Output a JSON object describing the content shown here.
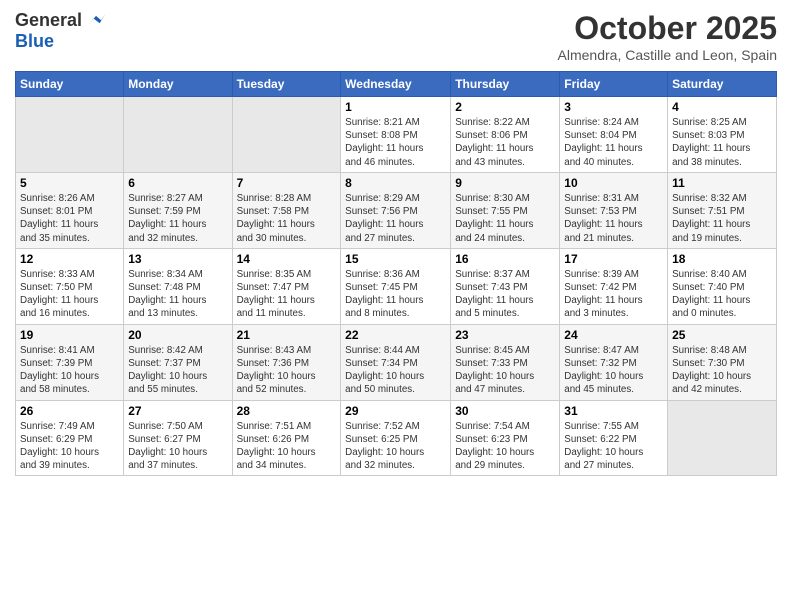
{
  "header": {
    "logo_general": "General",
    "logo_blue": "Blue",
    "month_title": "October 2025",
    "subtitle": "Almendra, Castille and Leon, Spain"
  },
  "weekdays": [
    "Sunday",
    "Monday",
    "Tuesday",
    "Wednesday",
    "Thursday",
    "Friday",
    "Saturday"
  ],
  "weeks": [
    [
      {
        "day": "",
        "info": ""
      },
      {
        "day": "",
        "info": ""
      },
      {
        "day": "",
        "info": ""
      },
      {
        "day": "1",
        "info": "Sunrise: 8:21 AM\nSunset: 8:08 PM\nDaylight: 11 hours\nand 46 minutes."
      },
      {
        "day": "2",
        "info": "Sunrise: 8:22 AM\nSunset: 8:06 PM\nDaylight: 11 hours\nand 43 minutes."
      },
      {
        "day": "3",
        "info": "Sunrise: 8:24 AM\nSunset: 8:04 PM\nDaylight: 11 hours\nand 40 minutes."
      },
      {
        "day": "4",
        "info": "Sunrise: 8:25 AM\nSunset: 8:03 PM\nDaylight: 11 hours\nand 38 minutes."
      }
    ],
    [
      {
        "day": "5",
        "info": "Sunrise: 8:26 AM\nSunset: 8:01 PM\nDaylight: 11 hours\nand 35 minutes."
      },
      {
        "day": "6",
        "info": "Sunrise: 8:27 AM\nSunset: 7:59 PM\nDaylight: 11 hours\nand 32 minutes."
      },
      {
        "day": "7",
        "info": "Sunrise: 8:28 AM\nSunset: 7:58 PM\nDaylight: 11 hours\nand 30 minutes."
      },
      {
        "day": "8",
        "info": "Sunrise: 8:29 AM\nSunset: 7:56 PM\nDaylight: 11 hours\nand 27 minutes."
      },
      {
        "day": "9",
        "info": "Sunrise: 8:30 AM\nSunset: 7:55 PM\nDaylight: 11 hours\nand 24 minutes."
      },
      {
        "day": "10",
        "info": "Sunrise: 8:31 AM\nSunset: 7:53 PM\nDaylight: 11 hours\nand 21 minutes."
      },
      {
        "day": "11",
        "info": "Sunrise: 8:32 AM\nSunset: 7:51 PM\nDaylight: 11 hours\nand 19 minutes."
      }
    ],
    [
      {
        "day": "12",
        "info": "Sunrise: 8:33 AM\nSunset: 7:50 PM\nDaylight: 11 hours\nand 16 minutes."
      },
      {
        "day": "13",
        "info": "Sunrise: 8:34 AM\nSunset: 7:48 PM\nDaylight: 11 hours\nand 13 minutes."
      },
      {
        "day": "14",
        "info": "Sunrise: 8:35 AM\nSunset: 7:47 PM\nDaylight: 11 hours\nand 11 minutes."
      },
      {
        "day": "15",
        "info": "Sunrise: 8:36 AM\nSunset: 7:45 PM\nDaylight: 11 hours\nand 8 minutes."
      },
      {
        "day": "16",
        "info": "Sunrise: 8:37 AM\nSunset: 7:43 PM\nDaylight: 11 hours\nand 5 minutes."
      },
      {
        "day": "17",
        "info": "Sunrise: 8:39 AM\nSunset: 7:42 PM\nDaylight: 11 hours\nand 3 minutes."
      },
      {
        "day": "18",
        "info": "Sunrise: 8:40 AM\nSunset: 7:40 PM\nDaylight: 11 hours\nand 0 minutes."
      }
    ],
    [
      {
        "day": "19",
        "info": "Sunrise: 8:41 AM\nSunset: 7:39 PM\nDaylight: 10 hours\nand 58 minutes."
      },
      {
        "day": "20",
        "info": "Sunrise: 8:42 AM\nSunset: 7:37 PM\nDaylight: 10 hours\nand 55 minutes."
      },
      {
        "day": "21",
        "info": "Sunrise: 8:43 AM\nSunset: 7:36 PM\nDaylight: 10 hours\nand 52 minutes."
      },
      {
        "day": "22",
        "info": "Sunrise: 8:44 AM\nSunset: 7:34 PM\nDaylight: 10 hours\nand 50 minutes."
      },
      {
        "day": "23",
        "info": "Sunrise: 8:45 AM\nSunset: 7:33 PM\nDaylight: 10 hours\nand 47 minutes."
      },
      {
        "day": "24",
        "info": "Sunrise: 8:47 AM\nSunset: 7:32 PM\nDaylight: 10 hours\nand 45 minutes."
      },
      {
        "day": "25",
        "info": "Sunrise: 8:48 AM\nSunset: 7:30 PM\nDaylight: 10 hours\nand 42 minutes."
      }
    ],
    [
      {
        "day": "26",
        "info": "Sunrise: 7:49 AM\nSunset: 6:29 PM\nDaylight: 10 hours\nand 39 minutes."
      },
      {
        "day": "27",
        "info": "Sunrise: 7:50 AM\nSunset: 6:27 PM\nDaylight: 10 hours\nand 37 minutes."
      },
      {
        "day": "28",
        "info": "Sunrise: 7:51 AM\nSunset: 6:26 PM\nDaylight: 10 hours\nand 34 minutes."
      },
      {
        "day": "29",
        "info": "Sunrise: 7:52 AM\nSunset: 6:25 PM\nDaylight: 10 hours\nand 32 minutes."
      },
      {
        "day": "30",
        "info": "Sunrise: 7:54 AM\nSunset: 6:23 PM\nDaylight: 10 hours\nand 29 minutes."
      },
      {
        "day": "31",
        "info": "Sunrise: 7:55 AM\nSunset: 6:22 PM\nDaylight: 10 hours\nand 27 minutes."
      },
      {
        "day": "",
        "info": ""
      }
    ]
  ]
}
